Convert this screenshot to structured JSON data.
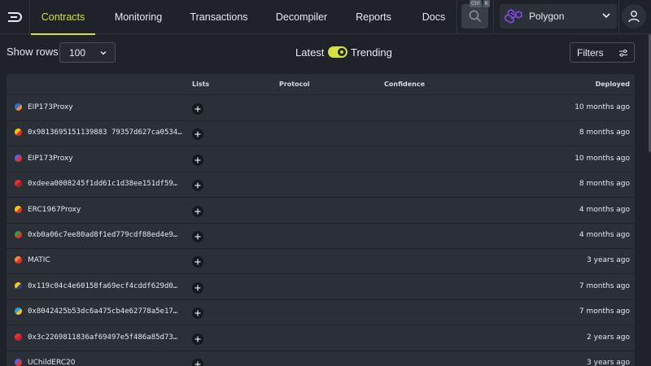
{
  "nav": {
    "tabs": [
      {
        "label": "Contracts",
        "active": true
      },
      {
        "label": "Monitoring"
      },
      {
        "label": "Transactions"
      },
      {
        "label": "Decompiler"
      },
      {
        "label": "Reports"
      },
      {
        "label": "Docs"
      }
    ],
    "search_shortcut": [
      "Ctrl",
      "K"
    ],
    "network": "Polygon"
  },
  "toolbar": {
    "rows_label": "Show rows",
    "rows_value": "100",
    "toggle_left": "Latest",
    "toggle_right": "Trending",
    "toggle_state": "Trending",
    "filters_label": "Filters"
  },
  "table": {
    "headers": {
      "lists": "Lists",
      "protocol": "Protocol",
      "confidence": "Confidence",
      "deployed": "Deployed"
    },
    "rows": [
      {
        "name": "EIP173Proxy",
        "deployed": "10 months ago",
        "colors": [
          "#2f6fe0",
          "#f28c28"
        ]
      },
      {
        "name": "0x9813695151139883 79357d627ca0534…",
        "deployed": "8 months ago",
        "colors": [
          "#f5c518",
          "#e5322d"
        ]
      },
      {
        "name": "EIP173Proxy",
        "deployed": "10 months ago",
        "colors": [
          "#6b5bd6",
          "#e5322d"
        ]
      },
      {
        "name": "0xdeea0008245f1dd61c1d38ee151df59…",
        "deployed": "8 months ago",
        "colors": [
          "#e5322d",
          "#b0202a"
        ]
      },
      {
        "name": "ERC1967Proxy",
        "deployed": "4 months ago",
        "colors": [
          "#f5c518",
          "#e5322d"
        ]
      },
      {
        "name": "0xb0a06c7ee80ad8f1ed779cdf88ed4e9…",
        "deployed": "4 months ago",
        "colors": [
          "#2f9e44",
          "#e5322d"
        ]
      },
      {
        "name": "MATIC",
        "deployed": "3 years ago",
        "colors": [
          "#f28c28",
          "#e5322d"
        ]
      },
      {
        "name": "0x119c04c4e60158fa69ecf4cddf629d0…",
        "deployed": "7 months ago",
        "colors": [
          "#f5c518",
          "#2f3a8f"
        ]
      },
      {
        "name": "0x8042425b53dc6a475cb4e62778a5e17…",
        "deployed": "7 months ago",
        "colors": [
          "#2f9ee0",
          "#f5c518"
        ]
      },
      {
        "name": "0x3c2269811836af69497e5f486a85d73…",
        "deployed": "2 years ago",
        "colors": [
          "#e5322d",
          "#c81e3a"
        ]
      },
      {
        "name": "UChildERC20",
        "deployed": "3 years ago",
        "colors": [
          "#6b5bd6",
          "#e5322d"
        ]
      }
    ]
  }
}
